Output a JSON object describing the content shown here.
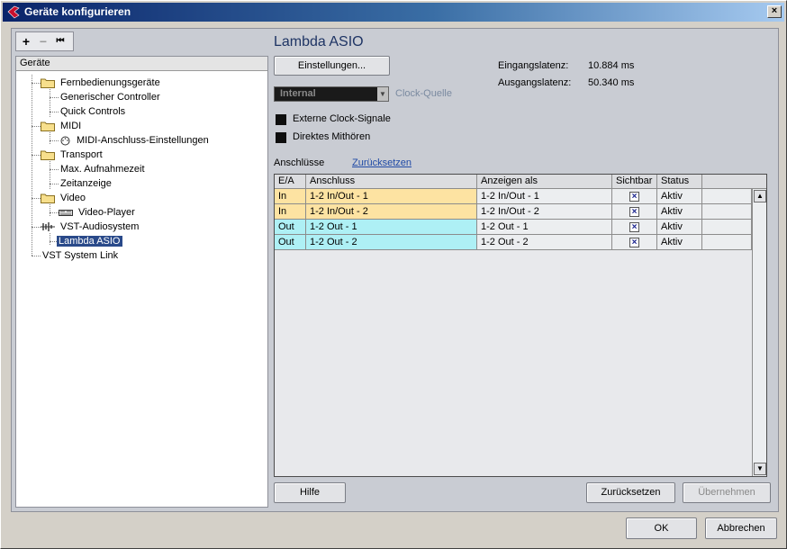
{
  "window": {
    "title": "Geräte konfigurieren",
    "close_glyph": "×"
  },
  "toolbar": {
    "add": "+",
    "remove": "−",
    "reset": "⏮"
  },
  "tree": {
    "header": "Geräte",
    "items": [
      {
        "label": "Fernbedienungsgeräte",
        "level": 1,
        "icon": "folder-icon"
      },
      {
        "label": "Generischer Controller",
        "level": 2
      },
      {
        "label": "Quick Controls",
        "level": 2
      },
      {
        "label": "MIDI",
        "level": 1,
        "icon": "folder-icon"
      },
      {
        "label": "MIDI-Anschluss-Einstellungen",
        "level": 2,
        "icon": "midi-port-icon"
      },
      {
        "label": "Transport",
        "level": 1,
        "icon": "folder-icon"
      },
      {
        "label": "Max. Aufnahmezeit",
        "level": 2
      },
      {
        "label": "Zeitanzeige",
        "level": 2
      },
      {
        "label": "Video",
        "level": 1,
        "icon": "folder-icon"
      },
      {
        "label": "Video-Player",
        "level": 2,
        "icon": "video-player-icon"
      },
      {
        "label": "VST-Audiosystem",
        "level": 1,
        "icon": "audio-system-icon"
      },
      {
        "label": "Lambda ASIO",
        "level": 2,
        "selected": true
      },
      {
        "label": "VST System Link",
        "level": 1
      }
    ]
  },
  "main": {
    "title": "Lambda ASIO",
    "settings_button": "Einstellungen...",
    "input_latency_label": "Eingangslatenz:",
    "input_latency_value": "10.884 ms",
    "output_latency_label": "Ausgangslatenz:",
    "output_latency_value": "50.340 ms",
    "clock_source_value": "Internal",
    "clock_source_label": "Clock-Quelle",
    "external_clock_label": "Externe Clock-Signale",
    "direct_monitoring_label": "Direktes Mithören",
    "ports_label": "Anschlüsse",
    "ports_reset_link": "Zurücksetzen"
  },
  "ports_table": {
    "columns": [
      "E/A",
      "Anschluss",
      "Anzeigen als",
      "Sichtbar",
      "Status"
    ],
    "rows": [
      {
        "io": "In",
        "port": "1-2 In/Out - 1",
        "display": "1-2 In/Out - 1",
        "visible": "×",
        "status": "Aktiv"
      },
      {
        "io": "In",
        "port": "1-2 In/Out - 2",
        "display": "1-2 In/Out - 2",
        "visible": "×",
        "status": "Aktiv"
      },
      {
        "io": "Out",
        "port": "1-2 Out - 1",
        "display": "1-2 Out - 1",
        "visible": "×",
        "status": "Aktiv"
      },
      {
        "io": "Out",
        "port": "1-2 Out - 2",
        "display": "1-2 Out - 2",
        "visible": "×",
        "status": "Aktiv"
      }
    ]
  },
  "footer": {
    "help_button": "Hilfe",
    "reset_button": "Zurücksetzen",
    "apply_button": "Übernehmen",
    "ok_button": "OK",
    "cancel_button": "Abbrechen"
  }
}
